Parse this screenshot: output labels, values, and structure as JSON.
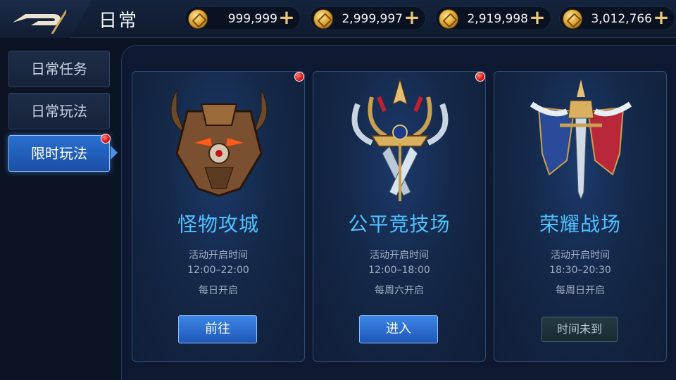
{
  "header": {
    "title": "日常",
    "currencies": [
      {
        "icon": "gold-coin-icon",
        "value": "999,999"
      },
      {
        "icon": "locked-gold-coin-icon",
        "value": "2,999,997"
      },
      {
        "icon": "coin-icon",
        "value": "2,919,998"
      },
      {
        "icon": "locked-coin-icon",
        "value": "3,012,766"
      }
    ],
    "plus_label": "+"
  },
  "sidebar": {
    "items": [
      {
        "label": "日常任务",
        "active": false
      },
      {
        "label": "日常玩法",
        "active": false
      },
      {
        "label": "限时玩法",
        "active": true
      }
    ]
  },
  "cards": [
    {
      "title": "怪物攻城",
      "time_label": "活动开启时间",
      "time": "12:00–22:00",
      "days": "每日开启",
      "button": "前往",
      "button_state": "active",
      "has_notice": true
    },
    {
      "title": "公平竞技场",
      "time_label": "活动开启时间",
      "time": "12:00–18:00",
      "days": "每周六开启",
      "button": "进入",
      "button_state": "active",
      "has_notice": true
    },
    {
      "title": "荣耀战场",
      "time_label": "活动开启时间",
      "time": "18:30–20:30",
      "days": "每周日开启",
      "button": "时间未到",
      "button_state": "disabled",
      "has_notice": false
    }
  ],
  "colors": {
    "accent": "#4fc2ff",
    "active_tab": "#2a6fd0",
    "notice_dot": "#e0141a",
    "currency_plus": "#e8c878"
  }
}
